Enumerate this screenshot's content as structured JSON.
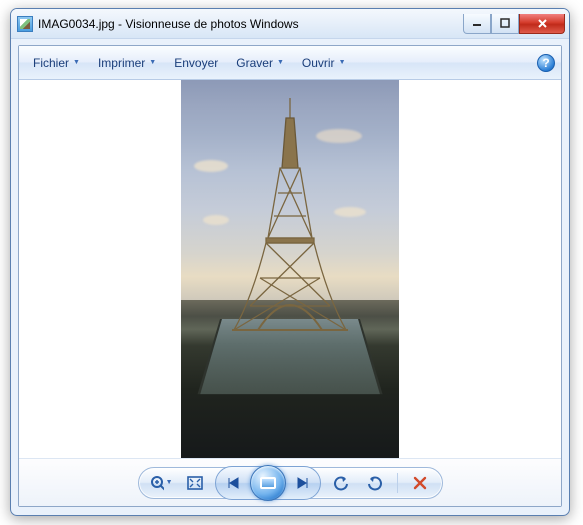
{
  "title": "IMAG0034.jpg - Visionneuse de photos Windows",
  "menus": {
    "file": "Fichier",
    "print": "Imprimer",
    "send": "Envoyer",
    "burn": "Graver",
    "open": "Ouvrir"
  },
  "controls": {
    "minimize": "Minimize",
    "maximize": "Maximize",
    "close": "Close",
    "help": "?"
  },
  "toolbar": {
    "zoom": "zoom",
    "fit": "fit-to-window",
    "prev": "previous",
    "slideshow": "slideshow",
    "next": "next",
    "rotate_ccw": "rotate-left",
    "rotate_cw": "rotate-right",
    "delete": "delete"
  },
  "image": {
    "filename": "IMAG0034.jpg",
    "subject": "Eiffel Tower at dusk"
  }
}
